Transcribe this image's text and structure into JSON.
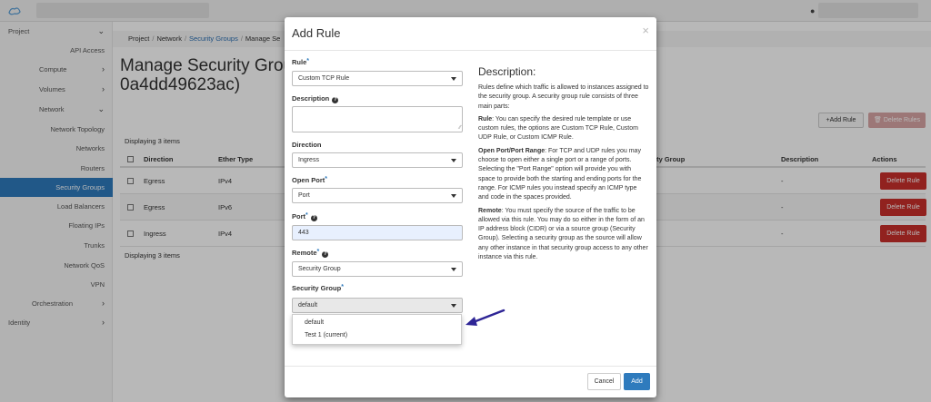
{
  "sidebar": {
    "items": [
      {
        "label": "Project"
      },
      {
        "label": "API Access"
      },
      {
        "label": "Compute"
      },
      {
        "label": "Volumes"
      },
      {
        "label": "Network"
      },
      {
        "label": "Network Topology"
      },
      {
        "label": "Networks"
      },
      {
        "label": "Routers"
      },
      {
        "label": "Security Groups"
      },
      {
        "label": "Load Balancers"
      },
      {
        "label": "Floating IPs"
      },
      {
        "label": "Trunks"
      },
      {
        "label": "Network QoS"
      },
      {
        "label": "VPN"
      },
      {
        "label": "Orchestration"
      },
      {
        "label": "Identity"
      }
    ]
  },
  "breadcrumb": {
    "project": "Project",
    "network": "Network",
    "security_groups": "Security Groups",
    "manage": "Manage Se",
    "sep": "/"
  },
  "page": {
    "title_line1": "Manage Security Grou",
    "title_line2": "0a4dd49623ac)",
    "add_rule_label": "+Add Rule",
    "delete_rules_label": "🗑 Delete Rules",
    "displaying_top": "Displaying 3 items",
    "displaying_bottom": "Displaying 3 items"
  },
  "table": {
    "headers": {
      "direction": "Direction",
      "ether_type": "Ether Type",
      "remote_security_group": "ity Group",
      "description": "Description",
      "actions": "Actions"
    },
    "rows": [
      {
        "direction": "Egress",
        "ether_type": "IPv4",
        "description": "-",
        "action": "Delete Rule"
      },
      {
        "direction": "Egress",
        "ether_type": "IPv6",
        "description": "-",
        "action": "Delete Rule"
      },
      {
        "direction": "Ingress",
        "ether_type": "IPv4",
        "description": "-",
        "action": "Delete Rule"
      }
    ]
  },
  "modal": {
    "title": "Add Rule",
    "close": "×",
    "fields": {
      "rule_label": "Rule",
      "rule_value": "Custom TCP Rule",
      "description_label": "Description",
      "direction_label": "Direction",
      "direction_value": "Ingress",
      "open_port_label": "Open Port",
      "open_port_value": "Port",
      "port_label": "Port",
      "port_value": "443",
      "remote_label": "Remote",
      "remote_value": "Security Group",
      "security_group_label": "Security Group",
      "security_group_value": "default",
      "security_group_options": [
        "default",
        "Test 1 (current)"
      ]
    },
    "required_mark": "*",
    "help_mark": "?",
    "description": {
      "heading": "Description:",
      "intro": "Rules define which traffic is allowed to instances assigned to the security group. A security group rule consists of three main parts:",
      "rule_title": "Rule",
      "rule_text": ": You can specify the desired rule template or use custom rules, the options are Custom TCP Rule, Custom UDP Rule, or Custom ICMP Rule.",
      "port_title": "Open Port/Port Range",
      "port_text": ": For TCP and UDP rules you may choose to open either a single port or a range of ports. Selecting the \"Port Range\" option will provide you with space to provide both the starting and ending ports for the range. For ICMP rules you instead specify an ICMP type and code in the spaces provided.",
      "remote_title": "Remote",
      "remote_text": ": You must specify the source of the traffic to be allowed via this rule. You may do so either in the form of an IP address block (CIDR) or via a source group (Security Group). Selecting a security group as the source will allow any other instance in that security group access to any other instance via this rule."
    },
    "cancel_label": "Cancel",
    "add_label": "Add"
  },
  "colors": {
    "primary": "#2f7bbd",
    "danger": "#c9302c",
    "arrow": "#2e2596"
  },
  "icons": [
    "logo-icon",
    "user-icon",
    "chevron-right-icon",
    "chevron-down-icon",
    "help-icon",
    "close-icon",
    "trash-icon",
    "arrow-annotation"
  ]
}
